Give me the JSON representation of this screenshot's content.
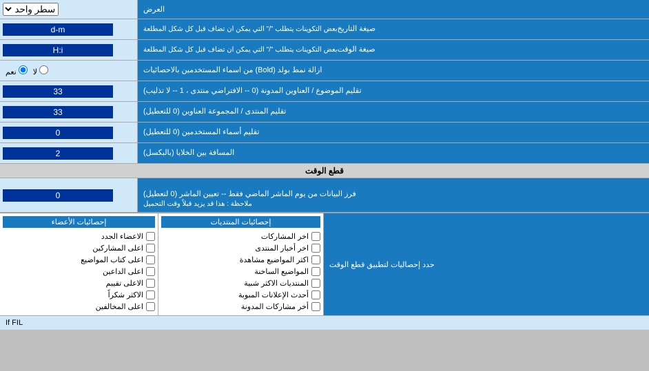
{
  "header": {
    "label": "العرض",
    "line_mode_label": "سطر واحد"
  },
  "date_format": {
    "label": "صيغة التاريخ",
    "sublabel": "بعض التكوينات يتطلب \"/\" التي يمكن ان تضاف قبل كل شكل المطلعة",
    "value": "d-m"
  },
  "time_format": {
    "label": "صيغة الوقت",
    "sublabel": "بعض التكوينات يتطلب \"/\" التي يمكن ان تضاف قبل كل شكل المطلعة",
    "value": "H:i"
  },
  "bold_remove": {
    "label": "ازالة نمط بولد (Bold) من اسماء المستخدمين بالاحصائيات",
    "option_yes": "نعم",
    "option_no": "لا"
  },
  "forums_order": {
    "label": "تقليم الموضوع / العناوين المدونة (0 -- الافتراضي منتدى ، 1 -- لا تذليب)",
    "value": "33"
  },
  "forum_group": {
    "label": "تقليم المنتدى / المجموعة العناوين (0 للتعطيل)",
    "value": "33"
  },
  "users_trim": {
    "label": "تقليم أسماء المستخدمين (0 للتعطيل)",
    "value": "0"
  },
  "cells_spacing": {
    "label": "المسافة بين الخلايا (بالبكسل)",
    "value": "2"
  },
  "time_cut_header": "قطع الوقت",
  "time_cut": {
    "label": "فرز البيانات من يوم الماشر الماضي فقط -- تعيين الماشر (0 لتعطيل)",
    "note": "ملاحظة : هذا قد يزيد قبلاً وقت التحميل",
    "value": "0"
  },
  "apply_stats_label": "حدد إحصاليات لتطبيق قطع الوقت",
  "stats_participations": {
    "title": "إحصائيات المنتديات",
    "items": [
      "اخر المشاركات",
      "اخر أخبار المنتدى",
      "اكثر المواضيع مشاهدة",
      "المواضيع الساخنة",
      "المنتديات الاكثر شبية",
      "أحدث الإعلانات المبوبة",
      "أخر مشاركات المدونة"
    ]
  },
  "stats_members": {
    "title": "إحصائيات الأعضاء",
    "items": [
      "الاعضاء الجدد",
      "اعلى المشاركين",
      "اعلى كتاب المواضيع",
      "اعلى الداعين",
      "الاعلى تقييم",
      "الاكثر شكراً",
      "اعلى المخالفين"
    ]
  },
  "if_fil_label": "If FIL"
}
